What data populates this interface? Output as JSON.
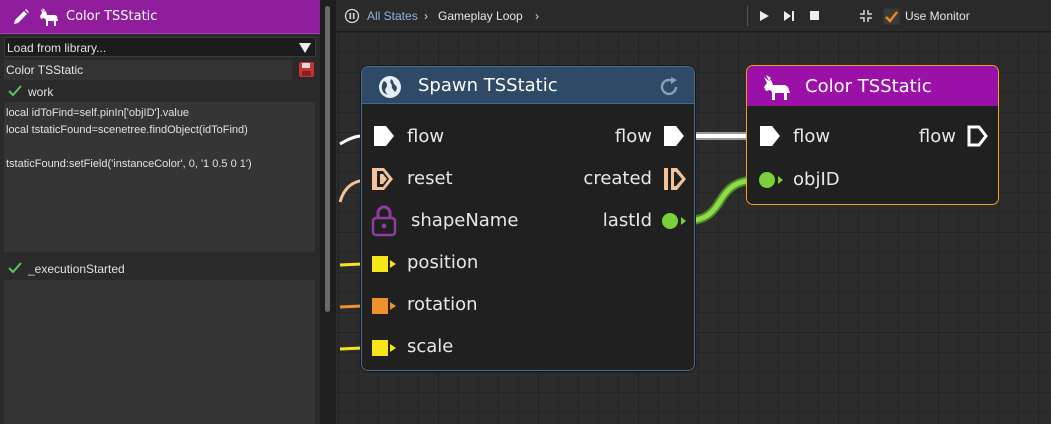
{
  "left_panel": {
    "node_title": "Color TSStatic",
    "library_select": "Load from library...",
    "name_field": "Color TSStatic",
    "work_section": {
      "label": "work",
      "code_lines": [
        "local idToFind=self.pinIn['objID'].value",
        "local tstaticFound=scenetree.findObject(idToFind)",
        "",
        "tstaticFound:setField('instanceColor', 0, '1 0.5 0 1')"
      ]
    },
    "execution_section": {
      "label": "_executionStarted"
    }
  },
  "toolbar": {
    "breadcrumb_root": "All States",
    "breadcrumb_sep": "›",
    "breadcrumb_current": "Gameplay Loop",
    "use_monitor_label": "Use Monitor",
    "use_monitor_checked": true
  },
  "spawn_node": {
    "title": "Spawn TSStatic",
    "icon": "globe-icon",
    "inputs": [
      {
        "label": "flow",
        "type": "flow",
        "color": "#ffffff"
      },
      {
        "label": "reset",
        "type": "impulse",
        "color": "#f4c39a"
      },
      {
        "label": "shapeName",
        "type": "locked",
        "color": "#8e3d9e"
      },
      {
        "label": "position",
        "type": "vec",
        "color": "#f5e61a"
      },
      {
        "label": "rotation",
        "type": "quat",
        "color": "#f0922b"
      },
      {
        "label": "scale",
        "type": "vec",
        "color": "#f5e61a"
      }
    ],
    "outputs": [
      {
        "label": "flow",
        "type": "flow",
        "color": "#ffffff"
      },
      {
        "label": "created",
        "type": "impulse",
        "color": "#f4c39a"
      },
      {
        "label": "lastId",
        "type": "number",
        "color": "#7ad03a"
      }
    ]
  },
  "color_node": {
    "title": "Color TSStatic",
    "icon": "goat-icon",
    "inputs": [
      {
        "label": "flow",
        "type": "flow",
        "color": "#ffffff"
      },
      {
        "label": "objID",
        "type": "number",
        "color": "#7ad03a"
      }
    ],
    "outputs": [
      {
        "label": "flow",
        "type": "flow",
        "color": "#ffffff"
      }
    ]
  },
  "colors": {
    "accent_purple": "#9b10a6",
    "selection_orange": "#f0a020",
    "spawn_header": "#2e4a66",
    "check_green": "#60c060"
  }
}
